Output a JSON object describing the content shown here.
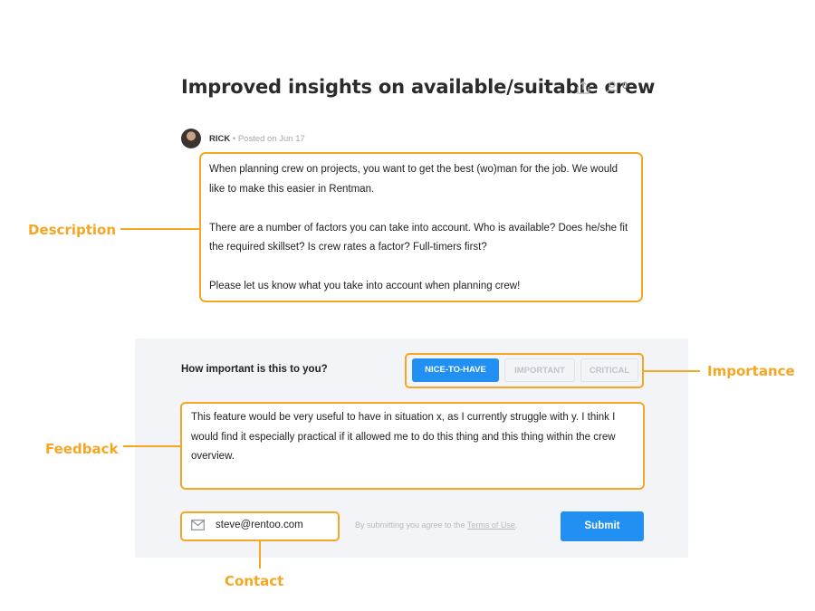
{
  "idea": {
    "title": "Improved insights on available/suitable crew",
    "follow_count": "0",
    "author": "RICK",
    "posted_on": "Posted on Jun 17",
    "description": [
      "When planning crew on projects, you want to get the best (wo)man for the job. We would like to make this easier in Rentman.",
      "There are a number of factors you can take into account. Who is available? Does he/she fit the required skillset? Is crew rates a factor? Full-timers first?",
      "Please let us know what you take into account when planning crew!"
    ]
  },
  "form": {
    "question": "How important is this to you?",
    "importance_options": [
      "NICE-TO-HAVE",
      "IMPORTANT",
      "CRITICAL"
    ],
    "selected_importance": "NICE-TO-HAVE",
    "feedback_value": "This feature would be very useful to have in situation x, as I currently struggle with y. I think I would find it especially practical if it allowed me to do this thing and this thing within the crew overview.",
    "contact_value": "steve@rentoo.com",
    "terms_prefix": "By submitting you agree to the ",
    "terms_link": "Terms of Use",
    "terms_suffix": ".",
    "submit_label": "Submit"
  },
  "annotations": {
    "description": "Description",
    "importance": "Importance",
    "feedback": "Feedback",
    "contact": "Contact"
  },
  "colors": {
    "annotation": "#f5a623",
    "primary": "#2290f2",
    "panel_bg": "#f2f4f7"
  },
  "icons": [
    "share-icon",
    "follow-user-icon",
    "mail-icon"
  ]
}
